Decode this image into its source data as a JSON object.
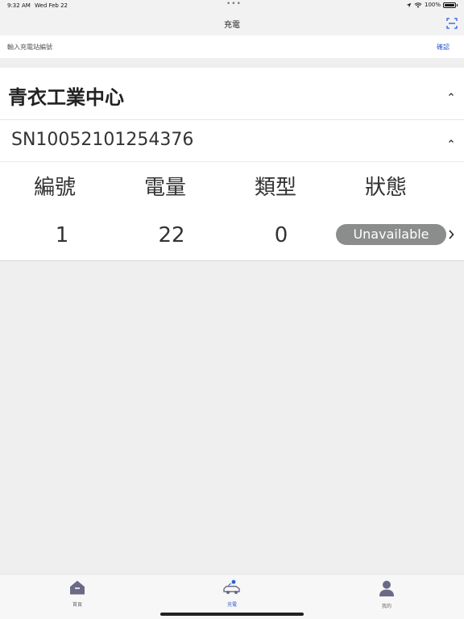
{
  "status_bar": {
    "time": "9:32 AM",
    "date": "Wed Feb 22",
    "dots": "•••",
    "battery": "100%"
  },
  "nav": {
    "title": "充電",
    "scan_icon": "scan-icon"
  },
  "search": {
    "placeholder": "輸入充電站編號",
    "confirm_label": "確認"
  },
  "station": {
    "name": "青衣工業中心",
    "serial": "SN10052101254376",
    "columns": [
      "編號",
      "電量",
      "類型",
      "狀態"
    ],
    "rows": [
      {
        "id": "1",
        "power": "22",
        "type": "0",
        "status": "Unavailable"
      }
    ]
  },
  "tabs": [
    {
      "label": "首頁",
      "icon": "home-icon",
      "active": false
    },
    {
      "label": "充電",
      "icon": "ev-car-icon",
      "active": true
    },
    {
      "label": "我的",
      "icon": "user-icon",
      "active": false
    }
  ],
  "colors": {
    "accent": "#2b5cd6",
    "status_pill": "#8a8d8c",
    "icon_dark": "#6b6a86"
  }
}
